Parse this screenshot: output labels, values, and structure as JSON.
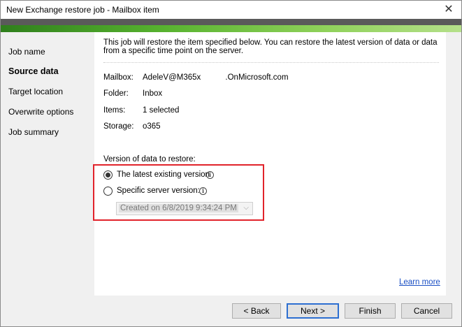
{
  "window": {
    "title": "New Exchange restore job - Mailbox item",
    "close_glyph": "✕"
  },
  "sidebar": {
    "items": [
      {
        "label": "Job name"
      },
      {
        "label": "Source data",
        "active": true
      },
      {
        "label": "Target location"
      },
      {
        "label": "Overwrite options"
      },
      {
        "label": "Job summary"
      }
    ]
  },
  "content": {
    "intro": "This job will restore the item specified below. You can restore the latest version of data or data from a specific time point on the server.",
    "properties": [
      {
        "label": "Mailbox:",
        "value": "AdeleV@M365x           .OnMicrosoft.com"
      },
      {
        "label": "Folder:",
        "value": "Inbox"
      },
      {
        "label": "Items:",
        "value": "1 selected"
      },
      {
        "label": "Storage:",
        "value": "o365"
      }
    ],
    "version_label": "Version of data to restore:",
    "options": {
      "latest": {
        "label": "The latest existing version",
        "checked": true
      },
      "specific": {
        "label": "Specific server version:",
        "checked": false
      }
    },
    "dropdown": {
      "value": "Created on 6/8/2019 9:34:24 PM",
      "enabled": false
    },
    "learn_more": "Learn more"
  },
  "footer": {
    "back": "< Back",
    "next": "Next >",
    "finish": "Finish",
    "cancel": "Cancel"
  },
  "icons": {
    "info": "i",
    "chevron": "⌵"
  },
  "colors": {
    "accent_green": "#57b22f",
    "highlight_red": "#e1232b",
    "link_blue": "#1a4fc4",
    "primary_border": "#2d6fd1"
  }
}
